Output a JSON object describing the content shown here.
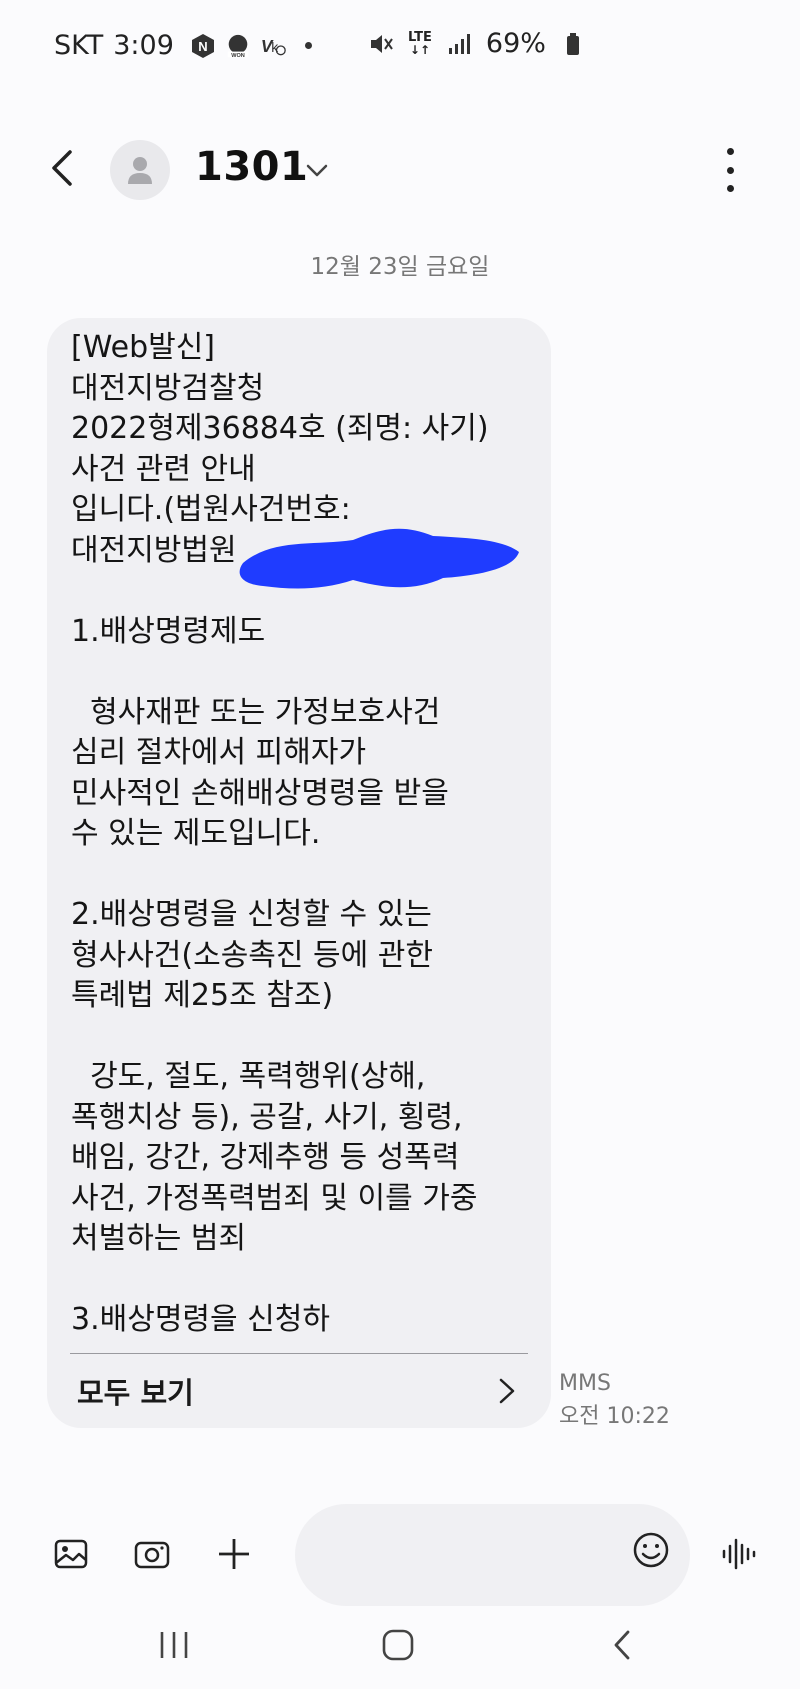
{
  "status_bar": {
    "carrier": "SKT",
    "time": "3:09",
    "network_label": "LTE",
    "battery": "69%"
  },
  "header": {
    "contact_name": "1301"
  },
  "conversation": {
    "date_label": "12월 23일 금요일"
  },
  "message": {
    "body": "[Web발신]\n대전지방검찰청\n2022형제36884호 (죄명: 사기)\n사건 관련 안내\n입니다.(법원사건번호:\n대전지방법원\n\n1.배상명령제도\n\n  형사재판 또는 가정보호사건\n심리 절차에서 피해자가\n민사적인 손해배상명령을 받을\n수 있는 제도입니다.\n\n2.배상명령을 신청할 수 있는\n형사사건(소송촉진 등에 관한\n특례법 제25조 참조)\n\n  강도, 절도, 폭력행위(상해,\n폭행치상 등), 공갈, 사기, 횡령,\n배임, 강간, 강제추행 등 성폭력\n사건, 가정폭력범죄 및 이를 가중\n처벌하는 범죄\n\n3.배상명령을 신청하",
    "view_all_label": "모두 보기",
    "type_label": "MMS",
    "timestamp": "오전 10:22"
  },
  "colors": {
    "bubble": "#f0f0f3",
    "background": "#fbfbfd",
    "redaction": "#1f3cff"
  }
}
